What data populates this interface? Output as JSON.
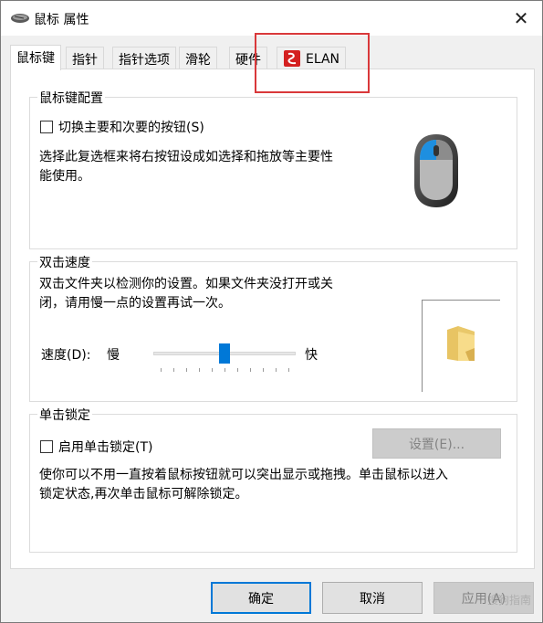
{
  "window": {
    "title": "鼠标 属性",
    "close_glyph": "✕"
  },
  "tabs": [
    {
      "label": "鼠标键",
      "active": true
    },
    {
      "label": "指针",
      "active": false
    },
    {
      "label": "指针选项",
      "active": false
    },
    {
      "label": "滑轮",
      "active": false
    },
    {
      "label": "硬件",
      "active": false
    },
    {
      "label": "ELAN",
      "active": false
    }
  ],
  "button_config": {
    "group_title": "鼠标键配置",
    "checkbox_label": "切换主要和次要的按钮(S)",
    "checked": false,
    "description_line1": "选择此复选框来将右按钮设成如选择和拖放等主要性",
    "description_line2": "能使用。"
  },
  "double_click": {
    "group_title": "双击速度",
    "description_line1": "双击文件夹以检测你的设置。如果文件夹没打开或关",
    "description_line2": "闭，请用慢一点的设置再试一次。",
    "speed_label": "速度(D):",
    "slow_label": "慢",
    "fast_label": "快",
    "speed_fraction": 0.5
  },
  "click_lock": {
    "group_title": "单击锁定",
    "checkbox_label": "启用单击锁定(T)",
    "checked": false,
    "settings_button": "设置(E)...",
    "description_line1": "使你可以不用一直按着鼠标按钮就可以突出显示或拖拽。单击鼠标以进入",
    "description_line2": "锁定状态,再次单击鼠标可解除锁定。"
  },
  "footer": {
    "ok": "确定",
    "cancel": "取消",
    "apply": "应用(A)"
  },
  "watermark": "搜狗指南",
  "colors": {
    "accent": "#0078d7",
    "highlight": "#d9383a",
    "folder": "#f5d67a"
  }
}
